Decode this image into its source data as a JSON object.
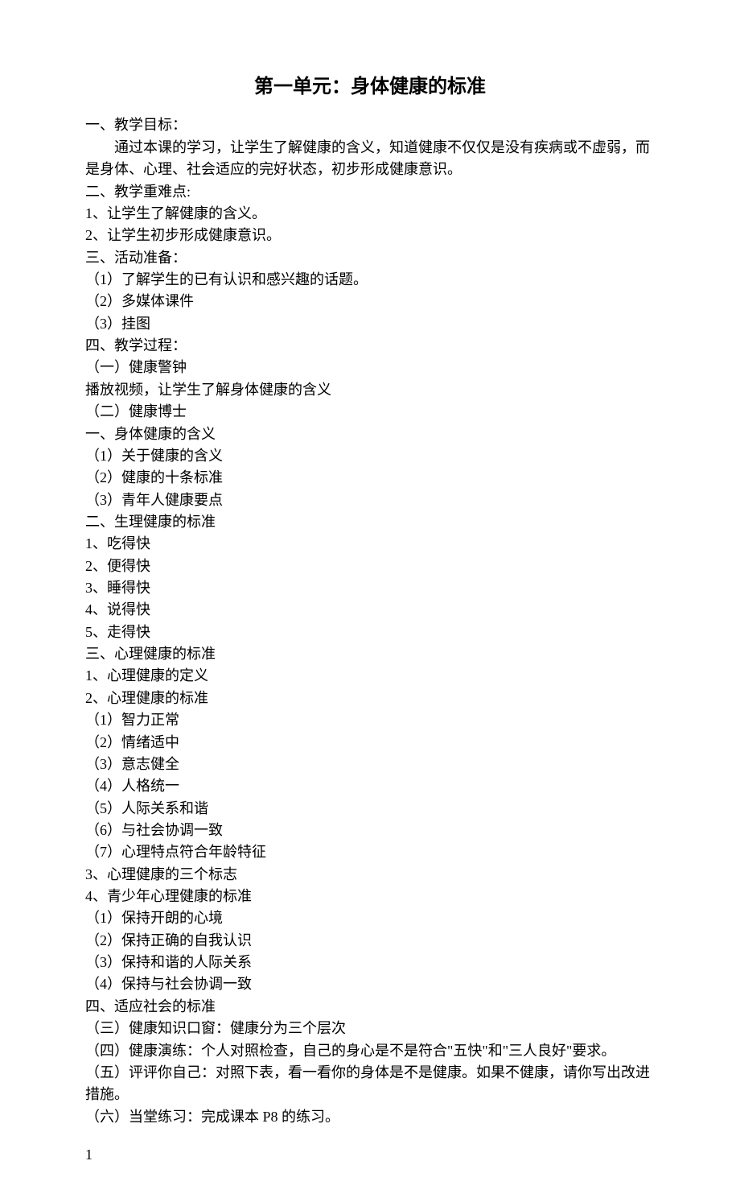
{
  "title": "第一单元：身体健康的标准",
  "lines": [
    "一、教学目标：",
    "INDENT:通过本课的学习，让学生了解健康的含义，知道健康不仅仅是没有疾病或不虚弱，而是身体、心理、社会适应的完好状态，初步形成健康意识。",
    "二、教学重难点:",
    "1、让学生了解健康的含义。",
    "2、让学生初步形成健康意识。",
    "三、活动准备：",
    "（1）了解学生的已有认识和感兴趣的话题。",
    "（2）多媒体课件",
    "（3）挂图",
    "四、教学过程：",
    "（一）健康警钟",
    "播放视频，让学生了解身体健康的含义",
    "（二）健康博士",
    "一、身体健康的含义",
    "（1）关于健康的含义",
    "（2）健康的十条标准",
    "（3）青年人健康要点",
    "二、生理健康的标准",
    "1、吃得快",
    "2、便得快",
    "3、睡得快",
    "4、说得快",
    "5、走得快",
    "三、心理健康的标准",
    "1、心理健康的定义",
    "2、心理健康的标准",
    "（1）智力正常",
    "（2）情绪适中",
    "（3）意志健全",
    "（4）人格统一",
    "（5）人际关系和谐",
    "（6）与社会协调一致",
    "（7）心理特点符合年龄特征",
    "3、心理健康的三个标志",
    "4、青少年心理健康的标准",
    "（1）保持开朗的心境",
    "（2）保持正确的自我认识",
    "（3）保持和谐的人际关系",
    "（4）保持与社会协调一致",
    "四、适应社会的标准",
    "（三）健康知识口窗：健康分为三个层次",
    "（四）健康演练：个人对照检查，自己的身心是不是符合\"五快\"和\"三人良好\"要求。",
    "（五）评评你自己：对照下表，看一看你的身体是不是健康。如果不健康，请你写出改进措施。",
    "（六）当堂练习：完成课本 P8 的练习。"
  ],
  "page_number": "1"
}
